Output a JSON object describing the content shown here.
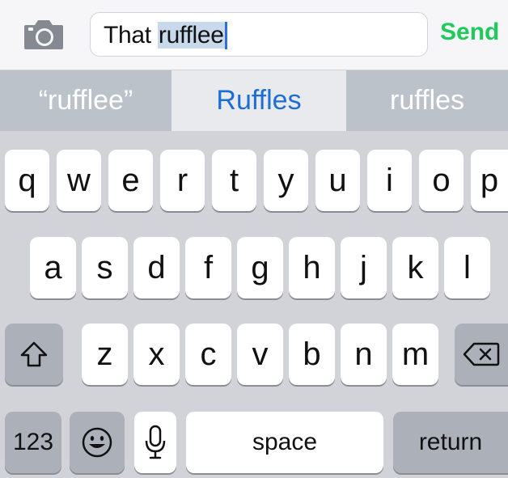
{
  "compose": {
    "text_plain": "That ",
    "text_selected": "rufflee",
    "send_label": "Send"
  },
  "suggestions": [
    {
      "label": "“rufflee”"
    },
    {
      "label": "Ruffles"
    },
    {
      "label": "ruffles"
    }
  ],
  "keyboard": {
    "row1": [
      "q",
      "w",
      "e",
      "r",
      "t",
      "y",
      "u",
      "i",
      "o",
      "p"
    ],
    "row2": [
      "a",
      "s",
      "d",
      "f",
      "g",
      "h",
      "j",
      "k",
      "l"
    ],
    "row3": [
      "z",
      "x",
      "c",
      "v",
      "b",
      "n",
      "m"
    ],
    "numbers_label": "123",
    "space_label": "space",
    "return_label": "return"
  },
  "icons": {
    "camera": "camera-icon",
    "shift": "shift-icon",
    "delete": "backspace-icon",
    "emoji": "emoji-icon",
    "microphone": "microphone-icon"
  },
  "colors": {
    "send": "#1fc95c",
    "selected_suggestion": "#1c6ed4",
    "caret": "#2f6fd6"
  }
}
